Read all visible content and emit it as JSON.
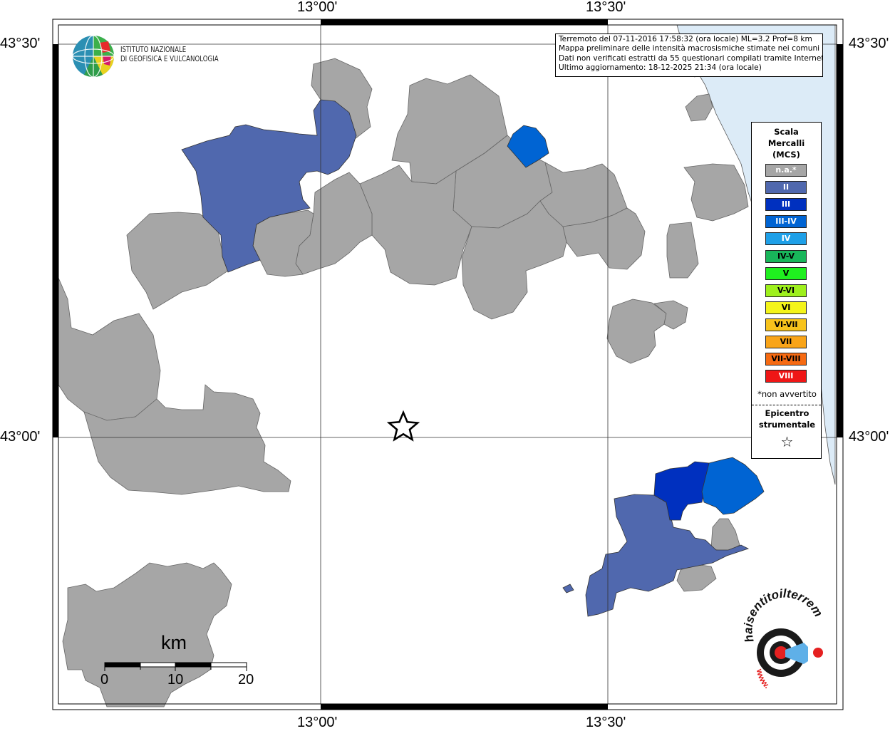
{
  "coordinates": {
    "top_left_lon": "13°00'",
    "top_right_lon": "13°30'",
    "bottom_left_lon": "13°00'",
    "bottom_right_lon": "13°30'",
    "left_top_lat": "43°30'",
    "left_bottom_lat": "43°00'",
    "right_top_lat": "43°30'",
    "right_bottom_lat": "43°00'"
  },
  "info": {
    "line1": "Terremoto del 07-11-2016 17:58:32 (ora locale) ML=3.2 Prof=8 km",
    "line2": "Mappa preliminare delle intensità macrosismiche stimate nei comuni",
    "line3": "Dati non verificati estratti da 55 questionari compilati tramite Internet.",
    "line4": "Ultimo aggiornamento: 18-12-2025 21:34 (ora locale)"
  },
  "logo": {
    "line1": "ISTITUTO NAZIONALE",
    "line2": "DI GEOFISICA E VULCANOLOGIA",
    "site": "haisentitoilterremoto.it",
    "site_prefix": "www."
  },
  "legend": {
    "title_line1": "Scala",
    "title_line2": "Mercalli",
    "title_line3": "(MCS)",
    "items": [
      {
        "label": "n.a.*",
        "color": "#a6a6a6",
        "text_color": "#ffffff"
      },
      {
        "label": "II",
        "color": "#5068ae",
        "text_color": "#ffffff"
      },
      {
        "label": "III",
        "color": "#0030bf",
        "text_color": "#ffffff"
      },
      {
        "label": "III-IV",
        "color": "#0064d3",
        "text_color": "#ffffff"
      },
      {
        "label": "IV",
        "color": "#1ea0e8",
        "text_color": "#ffffff"
      },
      {
        "label": "IV-V",
        "color": "#18b65a",
        "text_color": "#000000"
      },
      {
        "label": "V",
        "color": "#1fef1f",
        "text_color": "#000000"
      },
      {
        "label": "V-VI",
        "color": "#9ef01c",
        "text_color": "#000000"
      },
      {
        "label": "VI",
        "color": "#f4f41a",
        "text_color": "#000000"
      },
      {
        "label": "VI-VII",
        "color": "#f7c31c",
        "text_color": "#000000"
      },
      {
        "label": "VII",
        "color": "#f9a418",
        "text_color": "#000000"
      },
      {
        "label": "VII-VIII",
        "color": "#f66a12",
        "text_color": "#000000"
      },
      {
        "label": "VIII",
        "color": "#ef1616",
        "text_color": "#ffffff"
      }
    ],
    "note": "*non avvertito",
    "epicenter_line1": "Epicentro",
    "epicenter_line2": "strumentale",
    "epicenter_symbol": "☆"
  },
  "scale_bar": {
    "unit": "km",
    "labels": [
      "0",
      "10",
      "20"
    ]
  },
  "colors": {
    "na": "#a6a6a6",
    "ii": "#5068ae",
    "iii": "#0030bf",
    "iii_iv": "#0064d3",
    "sea": "#dcebf7"
  }
}
